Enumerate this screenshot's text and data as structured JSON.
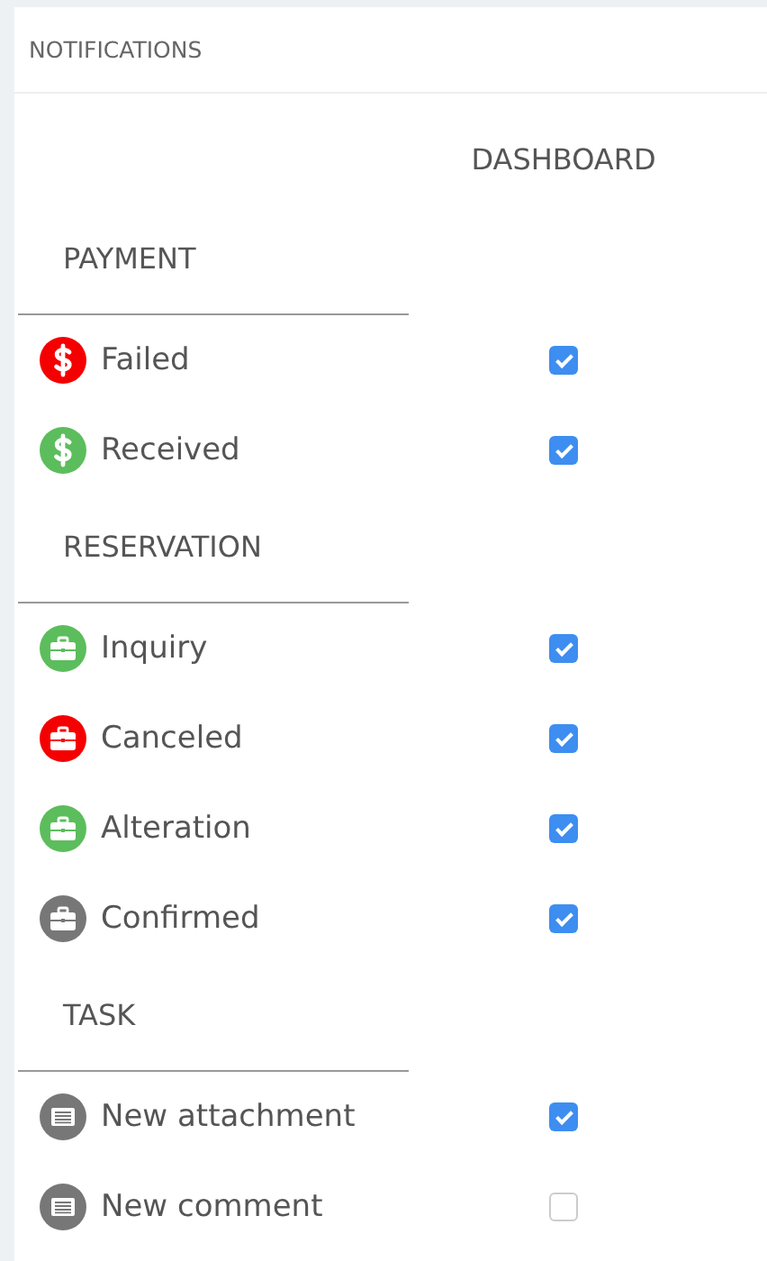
{
  "panel": {
    "title": "NOTIFICATIONS"
  },
  "columns": [
    "DASHBOARD"
  ],
  "sections": [
    {
      "title": "PAYMENT",
      "items": [
        {
          "label": "Failed",
          "kind": "dollar",
          "color": "#f50000",
          "checked": true
        },
        {
          "label": "Received",
          "kind": "dollar",
          "color": "#5cbd5c",
          "checked": true
        }
      ]
    },
    {
      "title": "RESERVATION",
      "items": [
        {
          "label": "Inquiry",
          "kind": "briefcase",
          "color": "#5cbd5c",
          "checked": true
        },
        {
          "label": "Canceled",
          "kind": "briefcase",
          "color": "#f50000",
          "checked": true
        },
        {
          "label": "Alteration",
          "kind": "briefcase",
          "color": "#5cbd5c",
          "checked": true
        },
        {
          "label": "Confirmed",
          "kind": "briefcase",
          "color": "#777777",
          "checked": true
        }
      ]
    },
    {
      "title": "TASK",
      "items": [
        {
          "label": "New attachment",
          "kind": "note",
          "color": "#777777",
          "checked": true
        },
        {
          "label": "New comment",
          "kind": "note",
          "color": "#777777",
          "checked": false
        }
      ]
    }
  ]
}
